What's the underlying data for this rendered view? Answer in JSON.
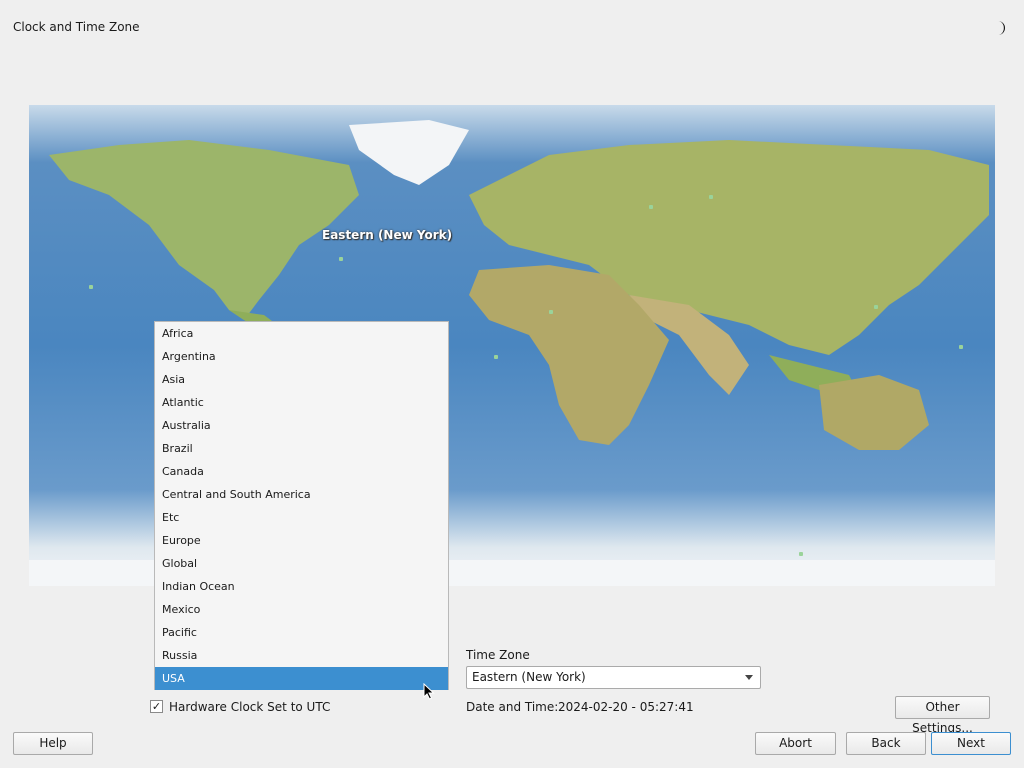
{
  "window": {
    "title": "Clock and Time Zone"
  },
  "icons": {
    "theme_toggle": "moon-icon"
  },
  "map": {
    "highlighted_zone_label": "Eastern (New York)"
  },
  "region_list": {
    "items": [
      "Africa",
      "Argentina",
      "Asia",
      "Atlantic",
      "Australia",
      "Brazil",
      "Canada",
      "Central and South America",
      "Etc",
      "Europe",
      "Global",
      "Indian Ocean",
      "Mexico",
      "Pacific",
      "Russia",
      "USA"
    ],
    "selected": "USA"
  },
  "time_zone": {
    "label": "Time Zone",
    "selected_value": "Eastern (New York)"
  },
  "hardware_clock": {
    "label": "Hardware Clock Set to UTC",
    "checked": true
  },
  "date_time": {
    "label": "Date and Time:",
    "value": "2024-02-20 - 05:27:41"
  },
  "buttons": {
    "other_settings": "Other Settings...",
    "help": "Help",
    "abort": "Abort",
    "back": "Back",
    "next": "Next"
  },
  "colors": {
    "selection": "#3c8fd0",
    "ocean": "#4a86c0",
    "land": "#8fae5a"
  }
}
